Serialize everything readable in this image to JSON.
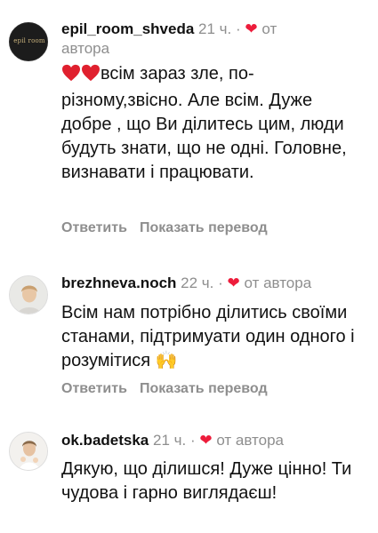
{
  "comments": [
    {
      "username": "epil_room_shveda",
      "time": "21 ч.",
      "dot": "·",
      "heart": "❤",
      "author_tag_first": "от",
      "author_tag_second": "автора",
      "avatar_text": "epil room",
      "text": "всім зараз зле, по-різному,звісно. Але всім. Дуже добре , що Ви ділитесь цим, люди будуть знати, що не одні. Головне, визнавати і працювати.",
      "emoji_prefix": "heart-emoji x2",
      "reply_label": "Ответить",
      "translate_label": "Показать перевод"
    },
    {
      "username": "brezhneva.noch",
      "time": "22 ч.",
      "dot": "·",
      "heart": "❤",
      "author_tag": "от автора",
      "text": "Всім нам потрібно ділитись своїми станами, підтримуати один одного і розумітися",
      "emoji_suffix": "🙌",
      "reply_label": "Ответить",
      "translate_label": "Показать перевод"
    },
    {
      "username": "ok.badetska",
      "time": "21 ч.",
      "dot": "·",
      "heart": "❤",
      "author_tag": "от автора",
      "text": "Дякую, що ділишся! Дуже цінно! Ти чудова і гарно виглядаєш!"
    }
  ],
  "colors": {
    "text": "#111111",
    "muted": "#8e8e8e",
    "heart": "#ed1c3b"
  }
}
